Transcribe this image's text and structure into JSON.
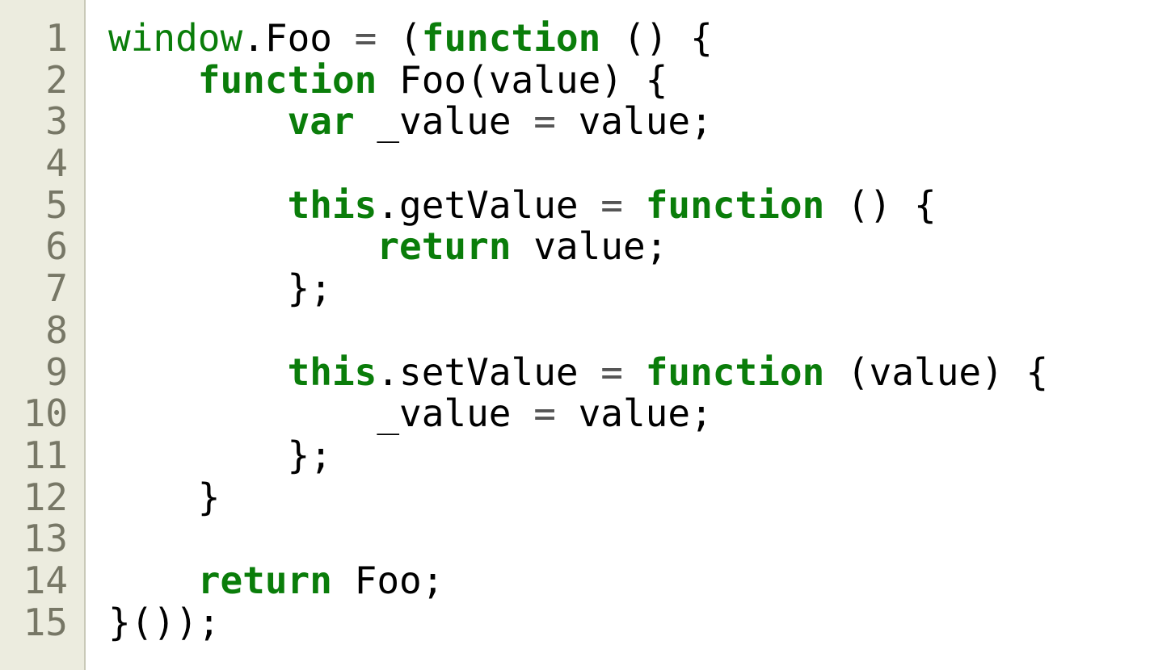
{
  "editor": {
    "line_numbers": [
      "1",
      "2",
      "3",
      "4",
      "5",
      "6",
      "7",
      "8",
      "9",
      "10",
      "11",
      "12",
      "13",
      "14",
      "15"
    ],
    "lines": [
      [
        {
          "t": "window",
          "c": "id-green"
        },
        {
          "t": "."
        },
        {
          "t": "Foo"
        },
        {
          "t": " "
        },
        {
          "t": "=",
          "c": "op"
        },
        {
          "t": " ("
        },
        {
          "t": "function",
          "c": "kw"
        },
        {
          "t": " () {"
        }
      ],
      [
        {
          "t": "    "
        },
        {
          "t": "function",
          "c": "kw"
        },
        {
          "t": " Foo(value) {"
        }
      ],
      [
        {
          "t": "        "
        },
        {
          "t": "var",
          "c": "kw"
        },
        {
          "t": " _value "
        },
        {
          "t": "=",
          "c": "op"
        },
        {
          "t": " value;"
        }
      ],
      [],
      [
        {
          "t": "        "
        },
        {
          "t": "this",
          "c": "kw"
        },
        {
          "t": ".getValue "
        },
        {
          "t": "=",
          "c": "op"
        },
        {
          "t": " "
        },
        {
          "t": "function",
          "c": "kw"
        },
        {
          "t": " () {"
        }
      ],
      [
        {
          "t": "            "
        },
        {
          "t": "return",
          "c": "kw"
        },
        {
          "t": " value;"
        }
      ],
      [
        {
          "t": "        };"
        }
      ],
      [],
      [
        {
          "t": "        "
        },
        {
          "t": "this",
          "c": "kw"
        },
        {
          "t": ".setValue "
        },
        {
          "t": "=",
          "c": "op"
        },
        {
          "t": " "
        },
        {
          "t": "function",
          "c": "kw"
        },
        {
          "t": " (value) {"
        }
      ],
      [
        {
          "t": "            _value "
        },
        {
          "t": "=",
          "c": "op"
        },
        {
          "t": " value;"
        }
      ],
      [
        {
          "t": "        };"
        }
      ],
      [
        {
          "t": "    }"
        }
      ],
      [],
      [
        {
          "t": "    "
        },
        {
          "t": "return",
          "c": "kw"
        },
        {
          "t": " Foo;"
        }
      ],
      [
        {
          "t": "}());"
        }
      ]
    ]
  },
  "colors": {
    "keyword": "#0a7d0a",
    "gutter_bg": "#ececdf",
    "line_number": "#777766",
    "text": "#000000"
  }
}
